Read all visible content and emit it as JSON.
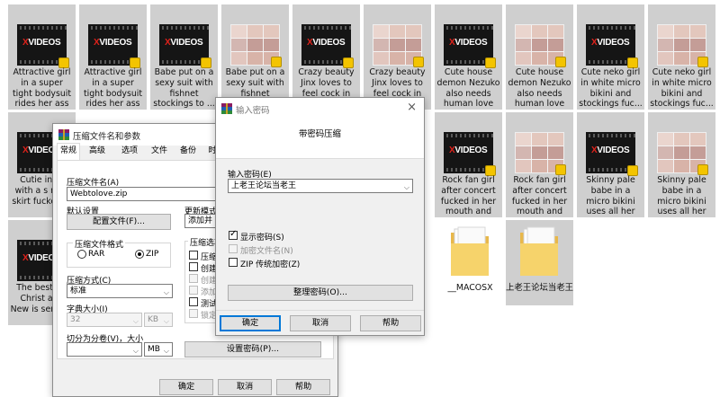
{
  "tiles": [
    {
      "kind": "xv",
      "caption": "Attractive girl in a super tight bodysuit rides her ass on a c..."
    },
    {
      "kind": "xv",
      "caption": "Attractive girl in a super tight bodysuit rides her ass on a c..."
    },
    {
      "kind": "xv",
      "caption": "Babe put on a sexy suit with fishnet stockings to ..."
    },
    {
      "kind": "collage",
      "caption": "Babe put on a sexy suit with fishnet"
    },
    {
      "kind": "xv",
      "caption": "Crazy beauty Jinx loves to feel cock in her"
    },
    {
      "kind": "collage",
      "caption": "Crazy beauty Jinx loves to feel cock in her"
    },
    {
      "kind": "xv",
      "caption": "Cute house demon Nezuko also needs human love a..."
    },
    {
      "kind": "collage",
      "caption": "Cute house demon Nezuko also needs human love a..."
    },
    {
      "kind": "xv",
      "caption": "Cute neko girl in white micro bikini and stockings fuc..."
    },
    {
      "kind": "collage",
      "caption": "Cute neko girl in white micro bikini and stockings fuc..."
    },
    {
      "kind": "xv",
      "caption": "Cutie in ur with a s mini skirt fucked in"
    },
    {
      "kind": "xv",
      "caption": "Rock fan girl after concert fucked in her mouth and he..."
    },
    {
      "kind": "collage",
      "caption": "Rock fan girl after concert fucked in her mouth and he..."
    },
    {
      "kind": "xv",
      "caption": "Skinny pale babe in a micro bikini uses all her holes, has..."
    },
    {
      "kind": "collage",
      "caption": "Skinny pale babe in a micro bikini uses all her holes, has..."
    },
    {
      "kind": "xv",
      "caption": "The best for Christ and New is sensual"
    }
  ],
  "xvideos_logo": {
    "x": "X",
    "rest": "VIDEOS"
  },
  "folders": [
    {
      "name": "__MACOSX"
    },
    {
      "name": "上老王论坛当老王"
    }
  ],
  "archive_dialog": {
    "title": "压缩文件名和参数",
    "tabs": [
      "常规",
      "高级",
      "选项",
      "文件",
      "备份",
      "时"
    ],
    "archive_name_label": "压缩文件名(A)",
    "archive_name_value": "Webtolove.zip",
    "default_settings_label": "默认设置",
    "profiles_button": "配置文件(F)...",
    "update_mode_label": "更新模式(",
    "update_mode_value": "添加并替",
    "format_group_label": "压缩文件格式",
    "format_rar": "RAR",
    "format_zip": "ZIP",
    "method_label": "压缩方式(C)",
    "method_value": "标准",
    "dict_label": "字典大小(I)",
    "dict_value": "32",
    "dict_unit": "KB",
    "split_label": "切分为分卷(V)，大小",
    "split_unit": "MB",
    "options_group_label": "压缩选项",
    "options": [
      {
        "text": "压缩",
        "checked": false,
        "disabled": false
      },
      {
        "text": "创建",
        "checked": false,
        "disabled": false
      },
      {
        "text": "创建",
        "checked": false,
        "disabled": true
      },
      {
        "text": "添加",
        "checked": false,
        "disabled": true
      },
      {
        "text": "测试",
        "checked": false,
        "disabled": false
      },
      {
        "text": "锁定",
        "checked": false,
        "disabled": true
      }
    ],
    "set_password_button": "设置密码(P)...",
    "ok": "确定",
    "cancel": "取消",
    "help": "帮助"
  },
  "password_dialog": {
    "title": "输入密码",
    "heading": "带密码压缩",
    "enter_label": "输入密码(E)",
    "password_value": "上老王论坛当老王",
    "show_password": "显示密码(S)",
    "encrypt_names": "加密文件名(N)",
    "zip_legacy": "ZIP 传统加密(Z)",
    "organize_button": "整理密码(O)...",
    "ok": "确定",
    "cancel": "取消",
    "help": "帮助",
    "close_glyph": "×"
  }
}
